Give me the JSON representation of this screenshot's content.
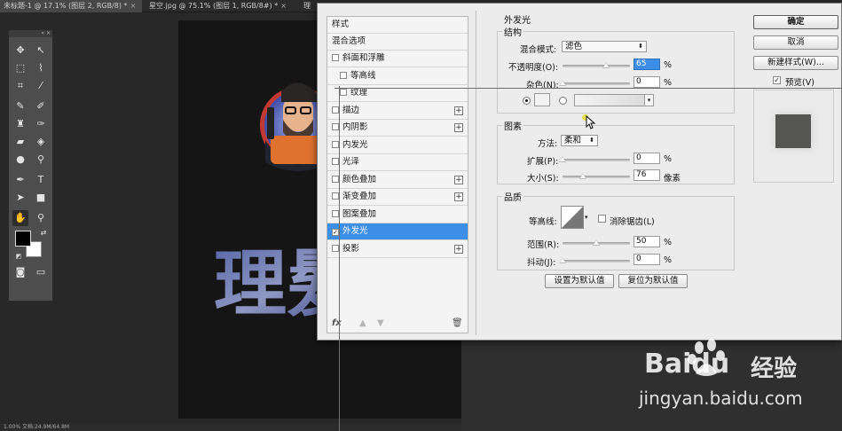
{
  "ps": {
    "tabs": [
      {
        "label": "未标题-1 @ 17.1% (图层 2, RGB/8) *",
        "close": "×"
      },
      {
        "label": "星空.jpg @ 75.1% (图层 1, RGB/8#) *",
        "close": "×"
      },
      {
        "label": "理",
        "close": ""
      }
    ],
    "status": "1.00%    文档:24.9M/64.8M"
  },
  "canvas_text": "理髮",
  "dialog": {
    "list": {
      "header_styles": "样式",
      "header_blend": "混合选项",
      "items": [
        {
          "label": "斜面和浮雕",
          "checked": false,
          "sub": false,
          "plus": false
        },
        {
          "label": "等高线",
          "checked": false,
          "sub": true,
          "plus": false
        },
        {
          "label": "纹理",
          "checked": false,
          "sub": true,
          "plus": false
        },
        {
          "label": "描边",
          "checked": false,
          "sub": false,
          "plus": true
        },
        {
          "label": "内阴影",
          "checked": false,
          "sub": false,
          "plus": true
        },
        {
          "label": "内发光",
          "checked": false,
          "sub": false,
          "plus": false
        },
        {
          "label": "光泽",
          "checked": false,
          "sub": false,
          "plus": false
        },
        {
          "label": "颜色叠加",
          "checked": false,
          "sub": false,
          "plus": true
        },
        {
          "label": "渐变叠加",
          "checked": false,
          "sub": false,
          "plus": true
        },
        {
          "label": "图案叠加",
          "checked": false,
          "sub": false,
          "plus": false
        },
        {
          "label": "外发光",
          "checked": true,
          "sub": false,
          "plus": false
        },
        {
          "label": "投影",
          "checked": false,
          "sub": false,
          "plus": true
        }
      ],
      "footer_fx": "fx",
      "check_mark": "✓"
    },
    "outer_glow": {
      "title": "外发光",
      "structure": {
        "title": "结构",
        "blend_mode_label": "混合模式:",
        "blend_mode_value": "滤色",
        "opacity_label": "不透明度(O):",
        "opacity_value": "65",
        "opacity_unit": "%",
        "opacity_fraction": 0.65,
        "noise_label": "杂色(N):",
        "noise_value": "0",
        "noise_unit": "%",
        "noise_fraction": 0.0,
        "color_swatch": "#f2f2f2"
      },
      "elements": {
        "title": "图素",
        "technique_label": "方法:",
        "technique_value": "柔和",
        "spread_label": "扩展(P):",
        "spread_value": "0",
        "spread_unit": "%",
        "spread_fraction": 0.0,
        "size_label": "大小(S):",
        "size_value": "76",
        "size_unit": "像素",
        "size_fraction": 0.3
      },
      "quality": {
        "title": "品质",
        "contour_label": "等高线:",
        "antialias_label": "消除锯齿(L)",
        "range_label": "范围(R):",
        "range_value": "50",
        "range_unit": "%",
        "range_fraction": 0.5,
        "jitter_label": "抖动(J):",
        "jitter_value": "0",
        "jitter_unit": "%",
        "jitter_fraction": 0.0
      },
      "make_default": "设置为默认值",
      "reset_default": "复位为默认值"
    },
    "buttons": {
      "ok": "确定",
      "cancel": "取消",
      "new_style": "新建样式(W)...",
      "preview_label": "预览(V)",
      "preview_checked": "✓"
    }
  },
  "watermark": {
    "brand": "Baidu",
    "cn": "经验",
    "url": "jingyan.baidu.com"
  }
}
